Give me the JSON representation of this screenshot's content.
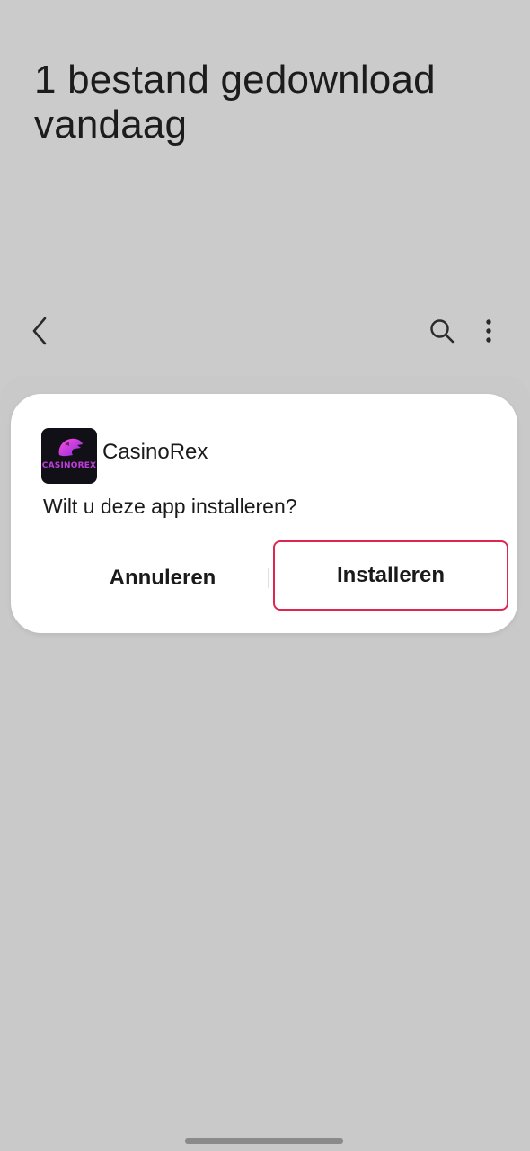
{
  "header": {
    "title": "1 bestand gedownload vandaag"
  },
  "toolbar": {
    "back_icon": "chevron-left-icon",
    "search_icon": "search-icon",
    "more_icon": "more-vertical-icon"
  },
  "dialog": {
    "app_icon": "casinorex-logo",
    "app_icon_wordmark": "CASINOREX",
    "app_name": "CasinoRex",
    "question": "Wilt u deze app installeren?",
    "cancel_label": "Annuleren",
    "install_label": "Installeren",
    "highlight_color": "#e0264e",
    "logo_color": "#c23be0"
  },
  "colors": {
    "background": "#cbcbcb",
    "dialog_background": "#ffffff",
    "text": "#1a1a1a"
  }
}
